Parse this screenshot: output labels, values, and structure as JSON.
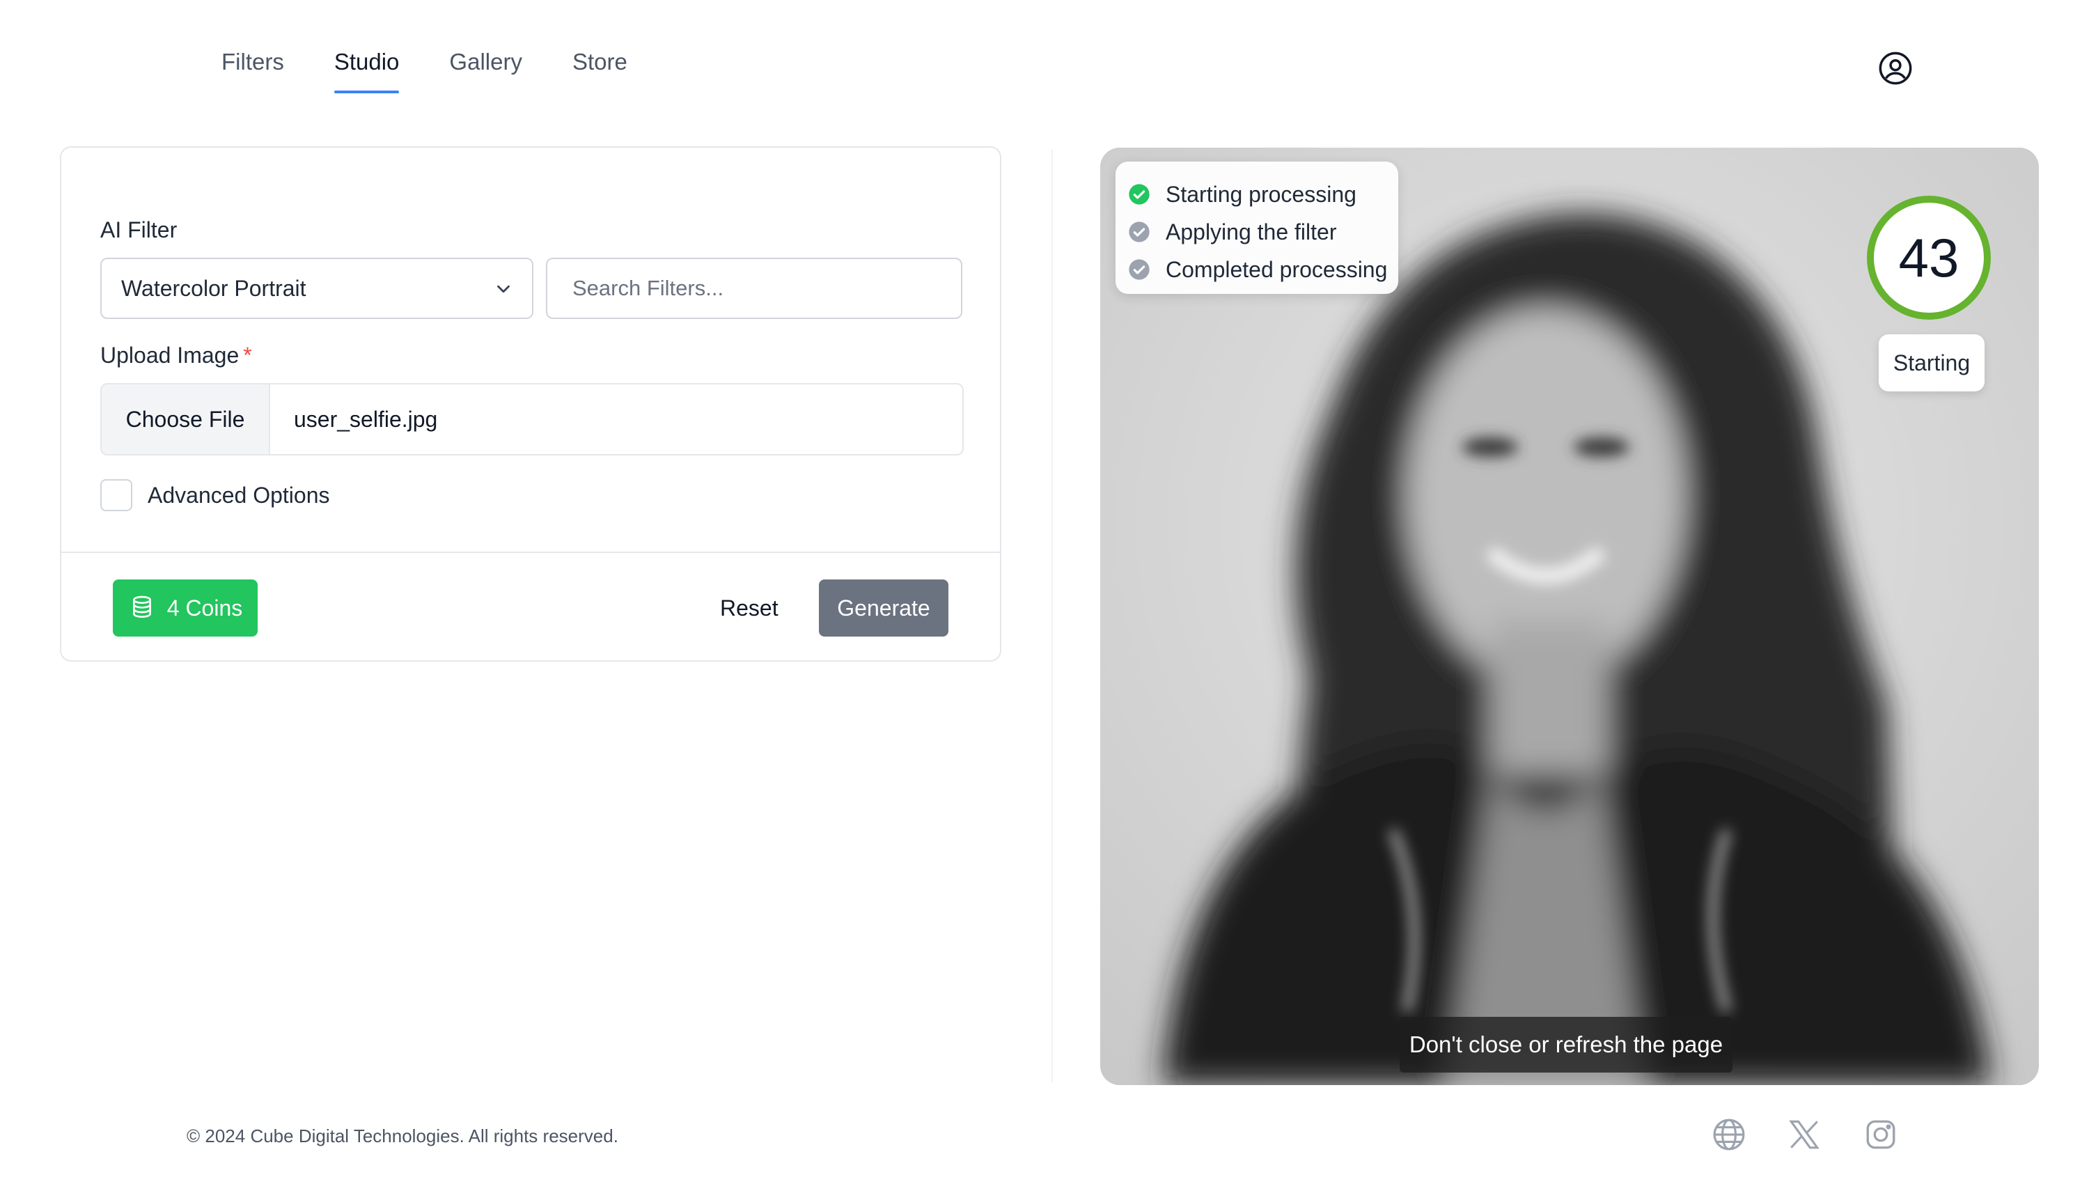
{
  "nav": {
    "tabs": [
      {
        "label": "Filters"
      },
      {
        "label": "Studio",
        "active": true
      },
      {
        "label": "Gallery"
      },
      {
        "label": "Store"
      }
    ],
    "account_icon": "user-circle-icon"
  },
  "form": {
    "filter_label": "AI Filter",
    "filter_selected": "Watercolor Portrait",
    "search_placeholder": "Search Filters...",
    "upload_label": "Upload Image",
    "required_mark": "*",
    "choose_file_label": "Choose File",
    "file_name": "user_selfie.jpg",
    "advanced_label": "Advanced Options",
    "advanced_checked": false,
    "coins_label": "4 Coins",
    "reset_label": "Reset",
    "generate_label": "Generate"
  },
  "preview": {
    "steps": [
      {
        "label": "Starting processing",
        "state": "done"
      },
      {
        "label": "Applying the filter",
        "state": "pending"
      },
      {
        "label": "Completed processing",
        "state": "pending"
      }
    ],
    "progress_value": "43",
    "progress_percent": 43,
    "status_label": "Starting",
    "warning": "Don't close or refresh the page"
  },
  "footer": {
    "copyright": "© 2024 Cube Digital Technologies. All rights reserved.",
    "social_icons": [
      "globe-icon",
      "x-logo-icon",
      "instagram-icon"
    ]
  },
  "colors": {
    "accent": "#3b82f6",
    "coins_green": "#22c55e",
    "progress_green": "#65b32e",
    "done_green": "#22c55e",
    "pending_gray": "#9ca3af",
    "generate_gray": "#6b7280"
  }
}
